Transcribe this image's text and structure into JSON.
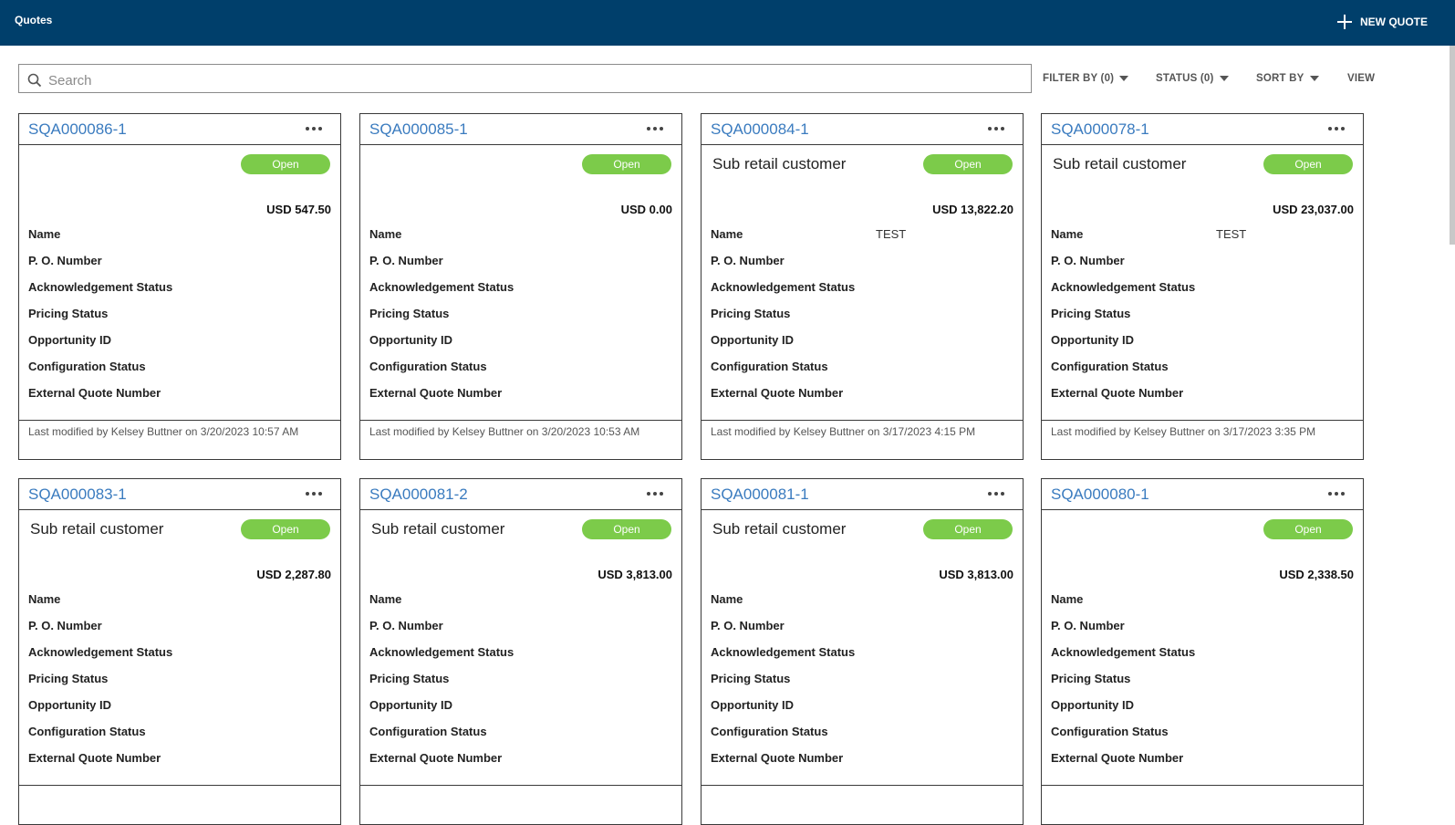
{
  "header": {
    "title": "Quotes",
    "new_quote_label": "NEW QUOTE"
  },
  "search": {
    "placeholder": "Search",
    "value": ""
  },
  "toolbar": {
    "filter_label": "FILTER BY (0)",
    "status_label": "STATUS (0)",
    "sort_label": "SORT BY",
    "view_label": "VIEW"
  },
  "field_labels": {
    "name": "Name",
    "po_number": "P. O. Number",
    "ack_status": "Acknowledgement Status",
    "pricing_status": "Pricing Status",
    "opportunity_id": "Opportunity ID",
    "config_status": "Configuration Status",
    "external_quote": "External Quote Number"
  },
  "cards": [
    {
      "id": "SQA000086-1",
      "customer": "",
      "status": "Open",
      "amount": "USD 547.50",
      "name_value": "",
      "modified": "Last modified by Kelsey Buttner on 3/20/2023 10:57 AM"
    },
    {
      "id": "SQA000085-1",
      "customer": "",
      "status": "Open",
      "amount": "USD 0.00",
      "name_value": "",
      "modified": "Last modified by Kelsey Buttner on 3/20/2023 10:53 AM"
    },
    {
      "id": "SQA000084-1",
      "customer": "Sub retail customer",
      "status": "Open",
      "amount": "USD 13,822.20",
      "name_value": "TEST",
      "modified": "Last modified by Kelsey Buttner on 3/17/2023 4:15 PM"
    },
    {
      "id": "SQA000078-1",
      "customer": "Sub retail customer",
      "status": "Open",
      "amount": "USD 23,037.00",
      "name_value": "TEST",
      "modified": "Last modified by Kelsey Buttner on 3/17/2023 3:35 PM"
    },
    {
      "id": "SQA000083-1",
      "customer": "Sub retail customer",
      "status": "Open",
      "amount": "USD 2,287.80",
      "name_value": "",
      "modified": ""
    },
    {
      "id": "SQA000081-2",
      "customer": "Sub retail customer",
      "status": "Open",
      "amount": "USD 3,813.00",
      "name_value": "",
      "modified": ""
    },
    {
      "id": "SQA000081-1",
      "customer": "Sub retail customer",
      "status": "Open",
      "amount": "USD 3,813.00",
      "name_value": "",
      "modified": ""
    },
    {
      "id": "SQA000080-1",
      "customer": "",
      "status": "Open",
      "amount": "USD 2,338.50",
      "name_value": "",
      "modified": ""
    }
  ]
}
